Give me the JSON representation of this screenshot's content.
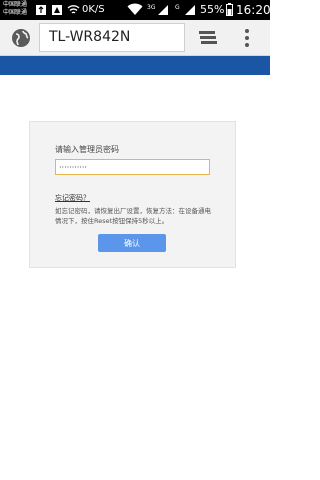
{
  "status_bar": {
    "carrier_top": "中国联通",
    "carrier_bottom": "中国联通",
    "net_speed": "0K/S",
    "net_type_1": "3G",
    "net_type_2": "G",
    "battery": "55%",
    "time": "16:20",
    "icons": [
      "usb-icon",
      "notification-icon",
      "wifi-calling-icon",
      "wifi-icon",
      "signal-icon",
      "battery-icon"
    ]
  },
  "browser": {
    "url": "TL-WR842N",
    "icons": [
      "globe-icon",
      "tabs-icon",
      "overflow-menu-icon"
    ]
  },
  "login": {
    "prompt": "请输入管理员密码",
    "password_mask": "···········",
    "forgot_link": "忘记密码？",
    "help_text": "如忘记密码，请恢复出厂设置，恢复方法：在设备通电情况下，按住Reset按钮保持5秒以上。",
    "confirm_label": "确认"
  },
  "colors": {
    "brand_blue": "#1a56a3",
    "button_blue": "#5b96ea",
    "input_focus": "#e8b54a"
  }
}
